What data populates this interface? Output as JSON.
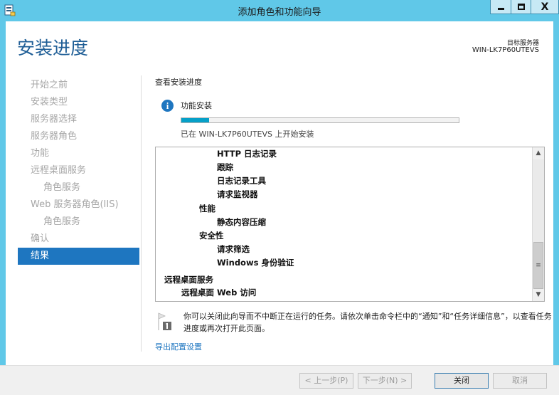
{
  "window": {
    "title": "添加角色和功能向导",
    "minimize_icon": "minimize-icon",
    "maximize_icon": "maximize-icon",
    "close_icon": "close-icon",
    "close_glyph": "X"
  },
  "header": {
    "title": "安装进度",
    "target_label": "目标服务器",
    "target_server": "WIN-LK7P60UTEVS"
  },
  "nav": {
    "items": [
      {
        "label": "开始之前",
        "indent": 0,
        "active": false
      },
      {
        "label": "安装类型",
        "indent": 0,
        "active": false
      },
      {
        "label": "服务器选择",
        "indent": 0,
        "active": false
      },
      {
        "label": "服务器角色",
        "indent": 0,
        "active": false
      },
      {
        "label": "功能",
        "indent": 0,
        "active": false
      },
      {
        "label": "远程桌面服务",
        "indent": 0,
        "active": false
      },
      {
        "label": "角色服务",
        "indent": 1,
        "active": false
      },
      {
        "label": "Web 服务器角色(IIS)",
        "indent": 0,
        "active": false
      },
      {
        "label": "角色服务",
        "indent": 1,
        "active": false
      },
      {
        "label": "确认",
        "indent": 0,
        "active": false
      },
      {
        "label": "结果",
        "indent": 0,
        "active": true
      }
    ]
  },
  "main": {
    "section_heading": "查看安装进度",
    "info_icon": "info-icon",
    "info_glyph": "i",
    "feature_label": "功能安装",
    "progress_fraction": 0.1,
    "status_text": "已在 WIN-LK7P60UTEVS 上开始安装",
    "results": [
      {
        "text": "HTTP 日志记录",
        "level": 3
      },
      {
        "text": "跟踪",
        "level": 3
      },
      {
        "text": "日志记录工具",
        "level": 3
      },
      {
        "text": "请求监视器",
        "level": 3
      },
      {
        "text": "性能",
        "level": 2
      },
      {
        "text": "静态内容压缩",
        "level": 3
      },
      {
        "text": "安全性",
        "level": 2
      },
      {
        "text": "请求筛选",
        "level": 3
      },
      {
        "text": "Windows 身份验证",
        "level": 3
      },
      {
        "text": "远程桌面服务",
        "level": 0
      },
      {
        "text": "远程桌面 Web 访问",
        "level": 1
      }
    ],
    "scroll_up_glyph": "▲",
    "scroll_down_glyph": "▼",
    "scroll_thumb_glyph": "≡",
    "note_icon": "flag-note-icon",
    "note_text": "你可以关闭此向导而不中断正在运行的任务。请依次单击命令栏中的“通知”和“任务详细信息”，以查看任务进度或再次打开此页面。",
    "export_link": "导出配置设置"
  },
  "footer": {
    "prev_label": "< 上一步(P)",
    "next_label": "下一步(N) >",
    "close_label": "关闭",
    "cancel_label": "取消"
  },
  "colors": {
    "titlebar": "#60c8e8",
    "accent": "#1e76c0",
    "progress_fill": "#06a0c8"
  }
}
